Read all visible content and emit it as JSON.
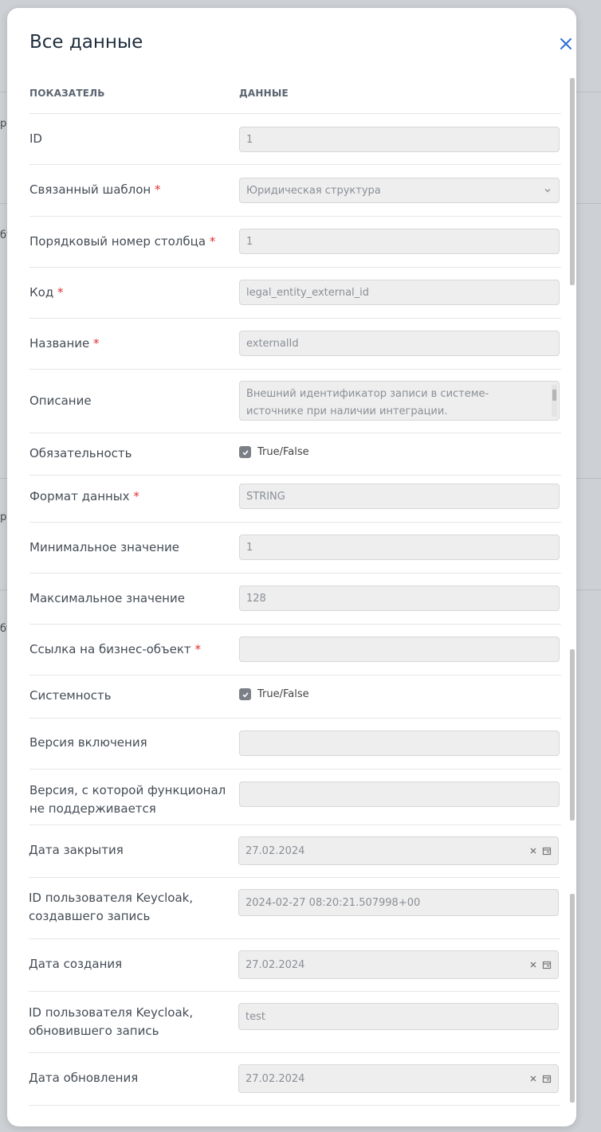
{
  "modal": {
    "title": "Все данные",
    "close_icon": "close-icon",
    "accent_color": "#2f6fd6"
  },
  "table": {
    "col_indicator": "ПОКАЗАТЕЛЬ",
    "col_data": "ДАННЫЕ"
  },
  "fields": {
    "id": {
      "label": "ID",
      "value": "1"
    },
    "template": {
      "label": "Связанный шаблон",
      "value": "Юридическая структура"
    },
    "column_number": {
      "label": "Порядковый номер столбца",
      "value": "1"
    },
    "code": {
      "label": "Код",
      "value": "legal_entity_external_id"
    },
    "name": {
      "label": "Название",
      "value": "externalId"
    },
    "description": {
      "label": "Описание",
      "value": "Внешний идентификатор записи в системе-источнике при наличии интеграции."
    },
    "required": {
      "label": "Обязательность",
      "option": "True/False",
      "checked": true
    },
    "data_format": {
      "label": "Формат данных",
      "value": "STRING"
    },
    "min_value": {
      "label": "Минимальное значение",
      "value": "1"
    },
    "max_value": {
      "label": "Максимальное значение",
      "value": "128"
    },
    "business_object_ref": {
      "label": "Ссылка на бизнес-объект",
      "value": ""
    },
    "system": {
      "label": "Системность",
      "option": "True/False",
      "checked": true
    },
    "version_on": {
      "label": "Версия включения",
      "value": ""
    },
    "version_unsupported": {
      "label_line1": "Версия, с которой функционал",
      "label_line2": "не поддерживается",
      "value": ""
    },
    "close_date": {
      "label": "Дата закрытия",
      "value": "27.02.2024"
    },
    "created_by": {
      "label_line1": "ID пользователя Keycloak,",
      "label_line2": "создавшего запись",
      "value": "2024-02-27 08:20:21.507998+00"
    },
    "created_date": {
      "label": "Дата создания",
      "value": "27.02.2024"
    },
    "updated_by": {
      "label_line1": "ID пользователя Keycloak,",
      "label_line2": "обновившего запись",
      "value": "test"
    },
    "updated_date": {
      "label": "Дата обновления",
      "value": "27.02.2024"
    }
  },
  "required_marker": "*",
  "background_fragments": [
    "ра",
    "бт",
    "ра",
    "бт"
  ]
}
